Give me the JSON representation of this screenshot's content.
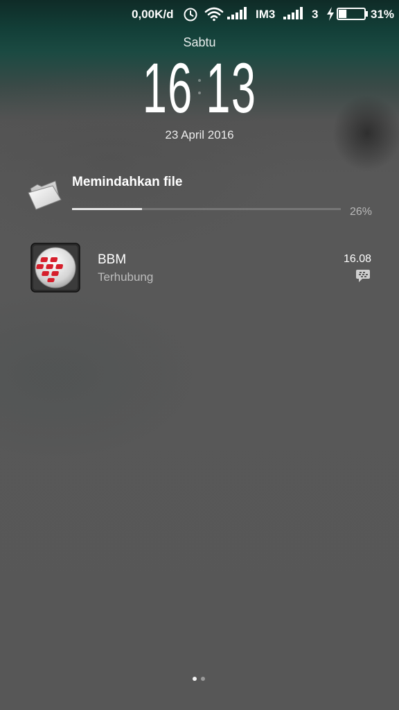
{
  "status_bar": {
    "network_speed": "0,00K/d",
    "carrier_1": "IM3",
    "carrier_2": "3",
    "battery_percent": "31%",
    "battery_level": 0.31,
    "icons": [
      "alarm-clock-icon",
      "wifi-icon",
      "signal-bars-icon",
      "signal-bars-icon",
      "charging-bolt-icon",
      "battery-icon"
    ]
  },
  "lockscreen": {
    "day": "Sabtu",
    "time": "16 13",
    "date": "23 April 2016"
  },
  "notifications": {
    "file_transfer": {
      "icon": "folder-icon",
      "title": "Memindahkan file",
      "progress_label": "26%",
      "progress": 0.26
    },
    "bbm": {
      "icon": "bbm-app-icon",
      "title": "BBM",
      "subtitle": "Terhubung",
      "time": "16.08",
      "badge_icon": "bbm-chat-icon"
    }
  },
  "page_indicator": {
    "count": 2,
    "active_index": 0
  },
  "colors": {
    "background": "#575757",
    "top_tint": "#123e37",
    "bbm_red": "#d61f2c"
  }
}
